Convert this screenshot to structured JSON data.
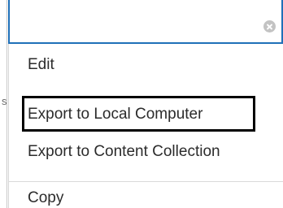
{
  "page_edge": {
    "fragment_text": "s"
  },
  "search_field": {
    "value": "",
    "clear_icon": "circle-x-icon"
  },
  "menu": {
    "items": [
      {
        "label": "Edit"
      },
      {
        "label": "Export to Local Computer"
      },
      {
        "label": "Export to Content Collection"
      },
      {
        "label": "Copy"
      }
    ],
    "highlighted_item": "Export to Local Computer"
  },
  "colors": {
    "field_border": "#1f70b8",
    "highlight_border": "#000000",
    "menu_text": "#2b2b2b",
    "clear_icon": "#c3c3c3"
  }
}
